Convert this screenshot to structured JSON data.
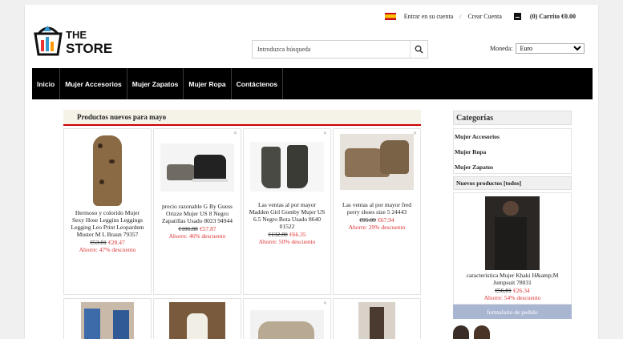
{
  "header": {
    "logo_text_top": "THE",
    "logo_text_bottom": "STORE",
    "login": "Entrar en su cuenta",
    "separator": "/",
    "create_account": "Crear Cuenta",
    "cart": "(0) Carrito €0.00",
    "search_placeholder": "Introduzca búsqueda",
    "currency_label": "Moneda:",
    "currency_selected": "Euro"
  },
  "nav": [
    "Inicio",
    "Mujer Accesorios",
    "Mujer Zapatos",
    "Mujer Ropa",
    "Contáctenos"
  ],
  "products_title": "Productos nuevos para mayo",
  "products": [
    {
      "name": "Hermoso y colorido Mujer Sexy Hose Leggins Leggings Legging Leo Print Leopardem Muster M L Braun 79357",
      "old": "€53.81",
      "new": "€28.47",
      "save": "Ahorre: 47% descuento"
    },
    {
      "name": "precio razonable G By Guess Orizze Mujer US 8 Negro Zapatillas Usado 8023 94944",
      "old": "€106.88",
      "new": "€57.87",
      "save": "Ahorre: 46% descuento"
    },
    {
      "name": "Las ventas al por mayor Madden Girl Gomby Mujer US 6.5 Negro Bota Usado 8640 01522",
      "old": "€132.80",
      "new": "€66.35",
      "save": "Ahorre: 50% descuento"
    },
    {
      "name": "Las ventas al por mayor fred perry shoes size 5 24443",
      "old": "€95.09",
      "new": "€67.94",
      "save": "Ahorre: 29% descuento"
    }
  ],
  "sidebar": {
    "categories_title": "Categorías",
    "categories": [
      "Mujer Accesorios",
      "Mujer Ropa",
      "Mujer Zapatos"
    ],
    "new_products_title": "Nuevos productos  [todos]",
    "featured": {
      "name": "característica Mujer Khaki H&amp;M Jumpsuit 78031",
      "old": "€56.81",
      "new": "€26.34",
      "save": "Ahorre: 54% descuento"
    },
    "order_button": "formulario de pedido"
  },
  "colors": {
    "accent": "#cc0000",
    "nav_bg": "#000000",
    "price_red": "#dd3333",
    "order_btn": "#a9b6d1"
  }
}
